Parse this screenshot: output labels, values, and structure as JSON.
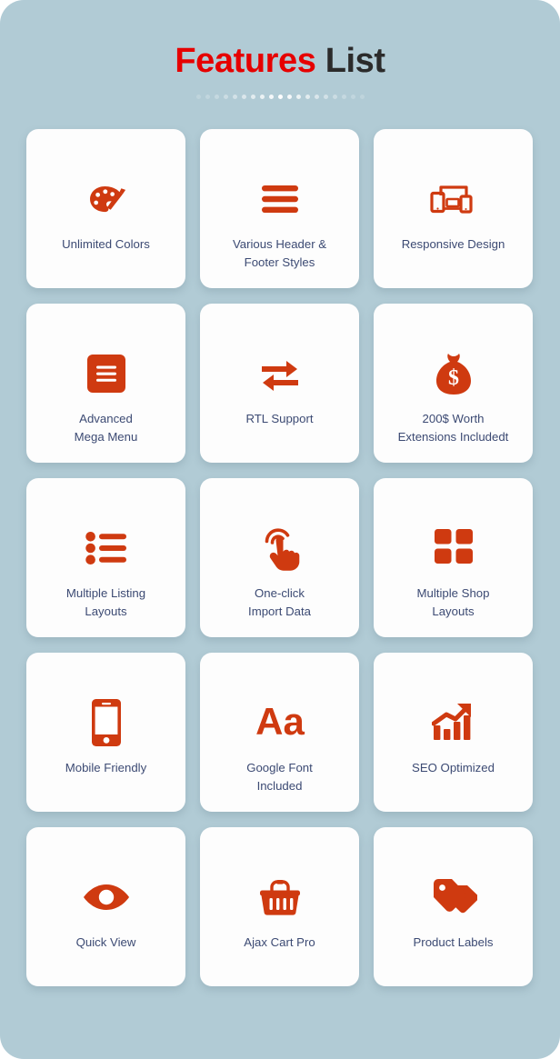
{
  "header": {
    "title_accent": "Features",
    "title_plain": "List",
    "accent_color": "#e60000",
    "plain_color": "#2b2b2b",
    "divider_dot_count": 19,
    "divider_dot_color": "#ffffff"
  },
  "theme": {
    "page_background": "#b1cbd5",
    "card_background": "#fdfdfd",
    "icon_color": "#cf3a10",
    "label_color": "#3c4a73"
  },
  "features": [
    {
      "label": "Unlimited Colors",
      "icon": "palette-icon"
    },
    {
      "label": "Various Header &\nFooter Styles",
      "icon": "bars-icon"
    },
    {
      "label": "Responsive Design",
      "icon": "responsive-devices-icon"
    },
    {
      "label": "Advanced\nMega Menu",
      "icon": "menu-square-icon"
    },
    {
      "label": "RTL Support",
      "icon": "exchange-arrows-icon"
    },
    {
      "label": "200$ Worth\nExtensions Includedt",
      "icon": "money-bag-icon"
    },
    {
      "label": "Multiple Listing\nLayouts",
      "icon": "bullet-list-icon"
    },
    {
      "label": "One-click\nImport Data",
      "icon": "hand-tap-icon"
    },
    {
      "label": "Multiple Shop\nLayouts",
      "icon": "grid-four-icon"
    },
    {
      "label": "Mobile Friendly",
      "icon": "mobile-phone-icon"
    },
    {
      "label": "Google Font\nIncluded",
      "icon": "aa-type-icon"
    },
    {
      "label": "SEO Optimized",
      "icon": "growth-chart-icon"
    },
    {
      "label": "Quick View",
      "icon": "eye-icon"
    },
    {
      "label": "Ajax Cart Pro",
      "icon": "shopping-basket-icon"
    },
    {
      "label": "Product Labels",
      "icon": "price-tags-icon"
    }
  ]
}
